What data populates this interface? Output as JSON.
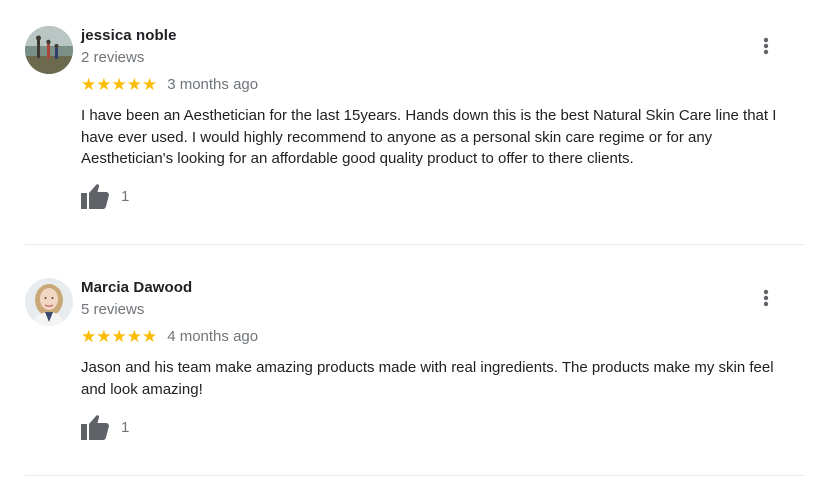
{
  "reviews": [
    {
      "name": "jessica noble",
      "review_count": "2 reviews",
      "rating": 5,
      "stars": "★★★★★",
      "when": "3 months ago",
      "text": "I have been an Aesthetician for the last 15years. Hands down this is the best Natural Skin Care line that I have ever used. I would highly recommend to anyone as a personal skin care regime or for any Aesthetician's looking for an affordable good quality product to offer to there clients.",
      "likes": "1"
    },
    {
      "name": "Marcia Dawood",
      "review_count": "5 reviews",
      "rating": 5,
      "stars": "★★★★★",
      "when": "4 months ago",
      "text": "Jason and his team make amazing products made with real ingredients. The products make my skin feel and look amazing!",
      "likes": "1"
    }
  ],
  "icons": {
    "like": "thumbs-up-icon",
    "menu": "more-vert-icon"
  },
  "colors": {
    "star": "#fbbc04",
    "secondary_text": "#70757a",
    "icon": "#5f6368"
  }
}
